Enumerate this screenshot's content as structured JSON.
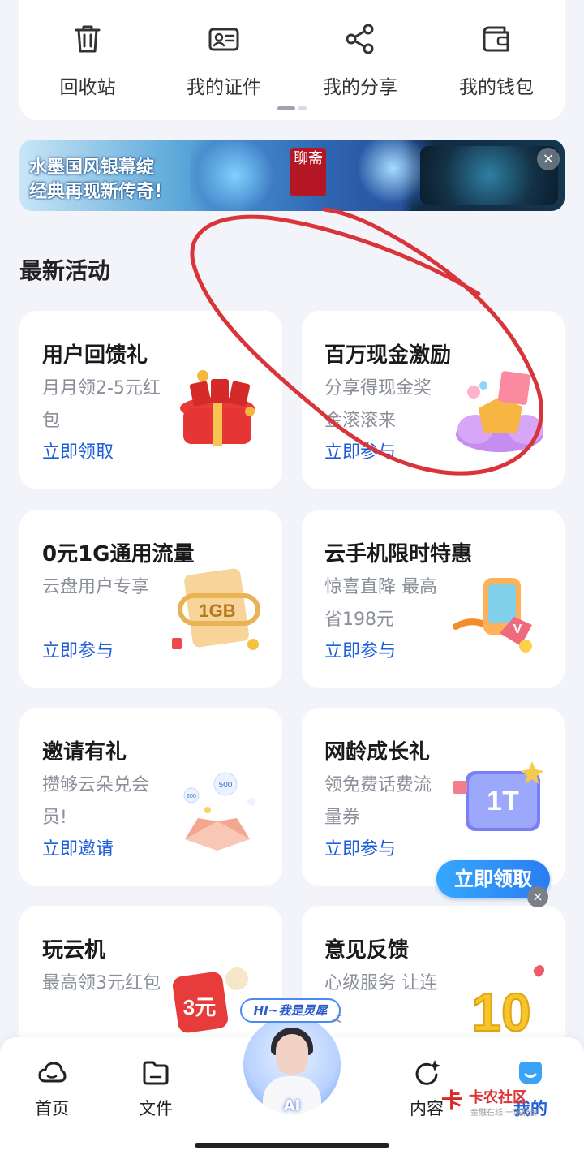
{
  "quick_actions": [
    {
      "label": "回收站",
      "icon": "trash-icon"
    },
    {
      "label": "我的证件",
      "icon": "id-card-icon"
    },
    {
      "label": "我的分享",
      "icon": "share-icon"
    },
    {
      "label": "我的钱包",
      "icon": "wallet-icon"
    }
  ],
  "banner": {
    "line1": "水墨国风银幕绽",
    "line2": "经典再现新传奇!",
    "seal_text": "聊斋"
  },
  "section": {
    "title": "最新活动"
  },
  "activities": [
    {
      "title": "用户回馈礼",
      "desc": "月月领2-5元红包",
      "cta": "立即领取"
    },
    {
      "title": "百万现金激励",
      "desc": "分享得现金奖金滚滚来",
      "cta": "立即参与"
    },
    {
      "title": "0元1G通用流量",
      "desc": "云盘用户专享",
      "cta": "立即参与"
    },
    {
      "title": "云手机限时特惠",
      "desc": "惊喜直降 最高省198元",
      "cta": "立即参与"
    },
    {
      "title": "邀请有礼",
      "desc": "攒够云朵兑会员!",
      "cta": "立即邀请"
    },
    {
      "title": "网龄成长礼",
      "desc": "领免费话费流量券",
      "cta": "立即参与"
    },
    {
      "title": "玩云机",
      "desc": "最高领3元红包",
      "cta": ""
    },
    {
      "title": "意见反馈",
      "desc": "心级服务 让连接",
      "cta": ""
    }
  ],
  "art_text": {
    "gb": "1GB",
    "tt": "1T",
    "coin500": "500",
    "coin200": "200",
    "three": "3元",
    "ten": "10"
  },
  "floating_promo": {
    "label": "立即领取",
    "close": "×"
  },
  "ai_assistant": {
    "bubble": "HI~我是灵犀",
    "label": "AI"
  },
  "bottom_nav": [
    {
      "label": "首页",
      "icon": "cloud-icon"
    },
    {
      "label": "文件",
      "icon": "folder-icon"
    },
    {
      "label": "内容",
      "icon": "sparkle-refresh-icon"
    },
    {
      "label": "我的",
      "icon": "profile-icon"
    }
  ],
  "watermark": {
    "main": "卡农社区",
    "sub": "金融在线 一站服务"
  },
  "colors": {
    "accent": "#1e5fd9",
    "annotation": "#d8343a",
    "background": "#f3f4f9"
  }
}
